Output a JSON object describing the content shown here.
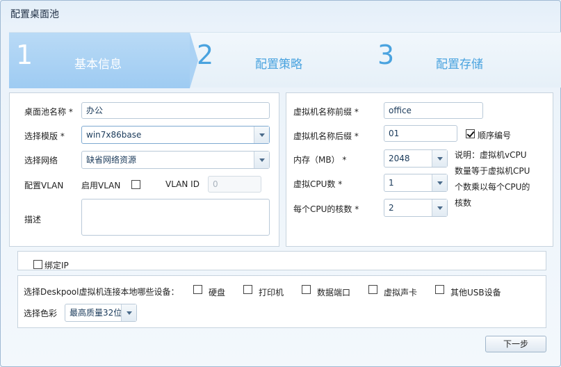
{
  "window": {
    "title": "配置桌面池"
  },
  "steps": [
    {
      "num": "1",
      "label": "基本信息"
    },
    {
      "num": "2",
      "label": "配置策略"
    },
    {
      "num": "3",
      "label": "配置存储"
    }
  ],
  "left": {
    "pool_name_label": "桌面池名称 *",
    "pool_name_value": "办公",
    "template_label": "选择模版 *",
    "template_value": "win7x86base",
    "network_label": "选择网络",
    "network_value": "缺省网络资源",
    "vlan_label": "配置VLAN",
    "enable_vlan_label": "启用VLAN",
    "enable_vlan_checked": false,
    "vlan_id_label": "VLAN ID",
    "vlan_id_value": "0",
    "desc_label": "描述",
    "desc_value": ""
  },
  "right": {
    "prefix_label": "虚拟机名称前缀 *",
    "prefix_value": "office",
    "suffix_label": "虚拟机名称后缀 *",
    "suffix_value": "01",
    "sequential_label": "顺序编号",
    "sequential_checked": true,
    "memory_label": "内存（MB） *",
    "memory_value": "2048",
    "cpu_label": "虚拟CPU数 *",
    "cpu_value": "1",
    "cores_label": "每个CPU的核数 *",
    "cores_value": "2",
    "note_lines": [
      "说明：虚拟机vCPU",
      "数量等于虚拟机CPU",
      "个数乘以每个CPU的",
      "核数"
    ]
  },
  "bind_ip": {
    "label": "绑定IP",
    "checked": false
  },
  "devices": {
    "label": "选择Deskpool虚拟机连接本地哪些设备：",
    "items": [
      {
        "label": "硬盘",
        "checked": false
      },
      {
        "label": "打印机",
        "checked": false
      },
      {
        "label": "数据端口",
        "checked": false
      },
      {
        "label": "虚拟声卡",
        "checked": false
      },
      {
        "label": "其他USB设备",
        "checked": false
      }
    ],
    "color_label": "选择色彩",
    "color_value": "最高质量32位"
  },
  "footer": {
    "next_label": "下一步"
  }
}
